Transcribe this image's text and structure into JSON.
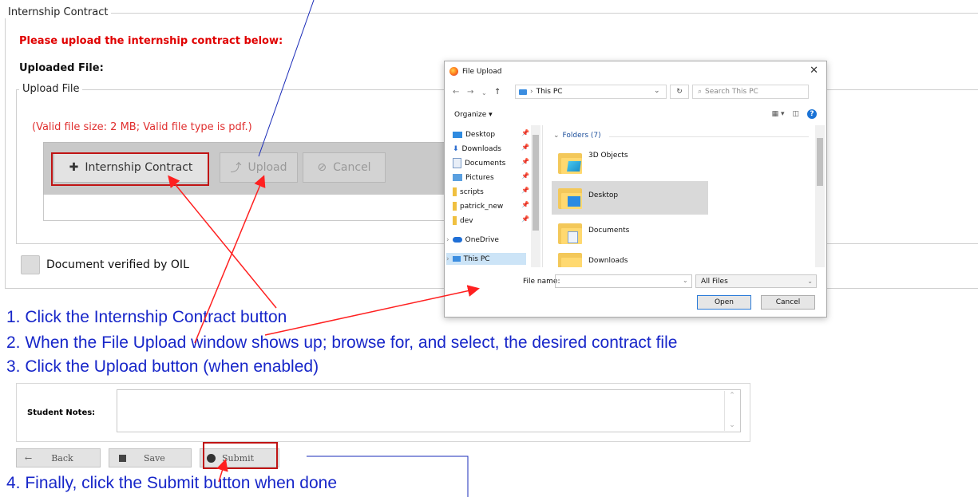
{
  "section": {
    "legend": "Internship Contract",
    "warning": "Please upload the internship contract below:",
    "uploaded_label": "Uploaded File:"
  },
  "upload": {
    "legend": "Upload File",
    "hint": "(Valid file size: 2 MB; Valid file type is pdf.)",
    "buttons": {
      "contract": "Internship Contract",
      "upload": "Upload",
      "cancel": "Cancel"
    }
  },
  "verified": {
    "label": "Document verified by OIL",
    "checked": false
  },
  "dialog": {
    "title": "File Upload",
    "address": "This PC",
    "search_placeholder": "Search This PC",
    "organize": "Organize ▾",
    "nav": [
      "Desktop",
      "Downloads",
      "Documents",
      "Pictures",
      "scripts",
      "patrick_new",
      "dev",
      "OneDrive",
      "This PC"
    ],
    "folders_header": "Folders (7)",
    "folders": [
      "3D Objects",
      "Desktop",
      "Documents",
      "Downloads"
    ],
    "filename_label": "File name:",
    "filename_value": "",
    "filter": "All Files",
    "open": "Open",
    "cancel": "Cancel"
  },
  "instructions": {
    "step1": "1.   Click the Internship Contract button",
    "step2": "2.   When the File Upload window shows up; browse for, and select, the desired contract file",
    "step3": "3.   Click the Upload button (when enabled)",
    "step4": "4. Finally, click the Submit button when done"
  },
  "notes": {
    "label": "Student Notes:",
    "value": ""
  },
  "actions": {
    "back": "Back",
    "save": "Save",
    "submit": "Submit"
  },
  "colors": {
    "warning": "#e00000",
    "instruction": "#1726c9",
    "highlight": "#c01414",
    "arrow": "#ff2020"
  }
}
